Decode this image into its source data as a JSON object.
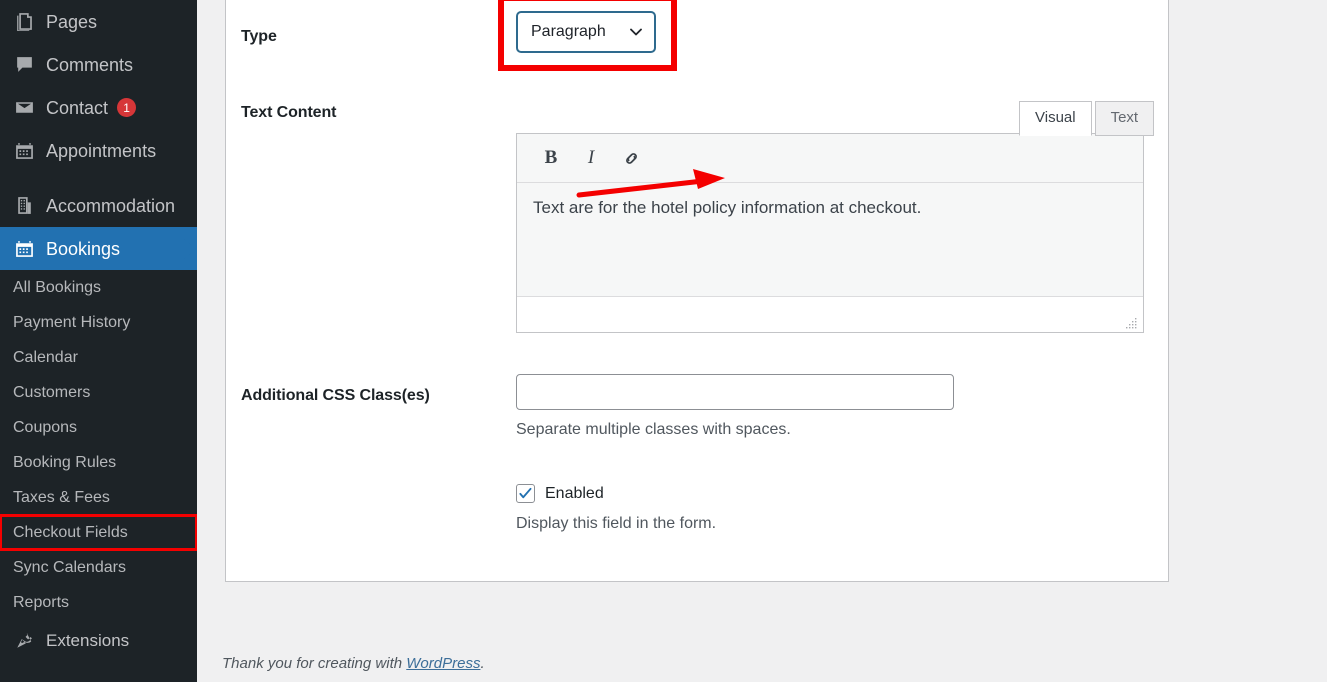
{
  "sidebar": {
    "top_items": [
      {
        "label": "Pages",
        "icon": "pages-icon",
        "badge": null,
        "active": false
      },
      {
        "label": "Comments",
        "icon": "comments-icon",
        "badge": null,
        "active": false
      },
      {
        "label": "Contact",
        "icon": "envelope-icon",
        "badge": "1",
        "active": false
      },
      {
        "label": "Appointments",
        "icon": "calendar-icon",
        "badge": null,
        "active": false
      },
      {
        "label": "Accommodation",
        "icon": "building-icon",
        "badge": null,
        "active": false
      },
      {
        "label": "Bookings",
        "icon": "calendar-icon",
        "badge": null,
        "active": true
      }
    ],
    "submenu_items": [
      {
        "label": "All Bookings",
        "highlighted": false
      },
      {
        "label": "Payment History",
        "highlighted": false
      },
      {
        "label": "Calendar",
        "highlighted": false
      },
      {
        "label": "Customers",
        "highlighted": false
      },
      {
        "label": "Coupons",
        "highlighted": false
      },
      {
        "label": "Booking Rules",
        "highlighted": false
      },
      {
        "label": "Taxes & Fees",
        "highlighted": false
      },
      {
        "label": "Checkout Fields",
        "highlighted": true
      },
      {
        "label": "Sync Calendars",
        "highlighted": false
      },
      {
        "label": "Reports",
        "highlighted": false
      }
    ],
    "extensions": {
      "label": "Extensions",
      "icon": "plug-icon"
    },
    "colors": {
      "background": "#1d2327",
      "active": "#2271b1",
      "badge": "#d63638",
      "text": "#c3c4c7"
    }
  },
  "form": {
    "type": {
      "label": "Type",
      "selected": "Paragraph",
      "icon": "chevron-down-icon",
      "highlight_color": "#f40000",
      "border_color": "#2e6a8e"
    },
    "text_content": {
      "label": "Text Content",
      "tabs": [
        {
          "label": "Visual",
          "active": true
        },
        {
          "label": "Text",
          "active": false
        }
      ],
      "toolbar": [
        {
          "label": "B",
          "name": "bold-icon"
        },
        {
          "label": "I",
          "name": "italic-icon"
        },
        {
          "label": "",
          "name": "link-icon"
        }
      ],
      "value": "Text are for the hotel policy information at checkout."
    },
    "css_class": {
      "label": "Additional CSS Class(es)",
      "value": "",
      "placeholder": "",
      "help": "Separate multiple classes with spaces."
    },
    "enabled": {
      "label": "Enabled",
      "checked": true,
      "help": "Display this field in the form."
    }
  },
  "footer": {
    "prefix": "Thank you for creating with ",
    "link": "WordPress",
    "suffix": "."
  }
}
